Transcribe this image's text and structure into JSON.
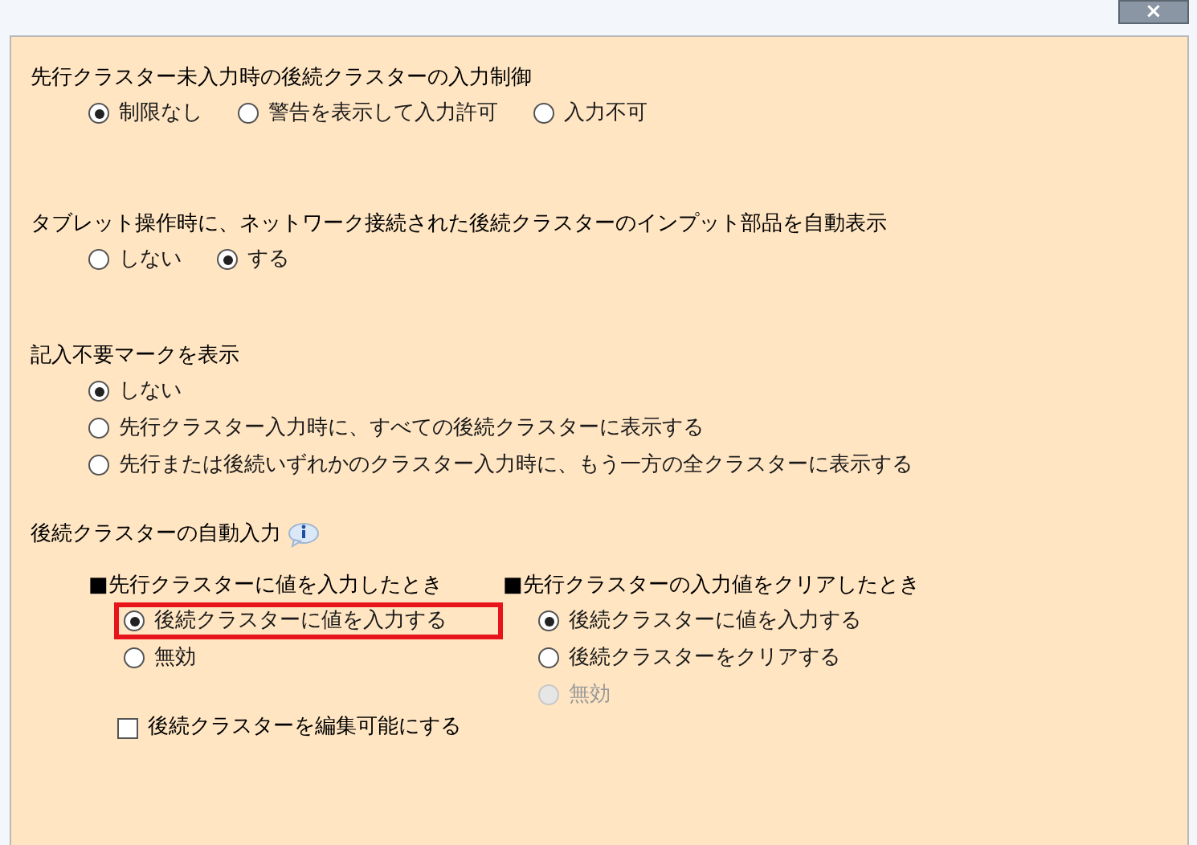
{
  "close_button": {
    "label": "×"
  },
  "sections": [
    {
      "title": "先行クラスター未入力時の後続クラスターの入力制御",
      "kind": "row",
      "options": [
        {
          "label": "制限なし",
          "selected": true
        },
        {
          "label": "警告を表示して入力許可",
          "selected": false
        },
        {
          "label": "入力不可",
          "selected": false
        }
      ]
    },
    {
      "title": "タブレット操作時に、ネットワーク接続された後続クラスターのインプット部品を自動表示",
      "kind": "row",
      "options": [
        {
          "label": "しない",
          "selected": false
        },
        {
          "label": "する",
          "selected": true
        }
      ]
    },
    {
      "title": "記入不要マークを表示",
      "kind": "column",
      "options": [
        {
          "label": "しない",
          "selected": true
        },
        {
          "label": "先行クラスター入力時に、すべての後続クラスターに表示する",
          "selected": false
        },
        {
          "label": "先行または後続いずれかのクラスター入力時に、もう一方の全クラスターに表示する",
          "selected": false
        }
      ]
    }
  ],
  "auto_input": {
    "title": "後続クラスターの自動入力",
    "groups": [
      {
        "heading": "■先行クラスターに値を入力したとき",
        "options": [
          {
            "label": "後続クラスターに値を入力する",
            "selected": true,
            "disabled": false,
            "highlighted": true
          },
          {
            "label": "無効",
            "selected": false,
            "disabled": false,
            "highlighted": false
          }
        ],
        "checkbox": {
          "label": "後続クラスターを編集可能にする",
          "checked": false
        }
      },
      {
        "heading": "■先行クラスターの入力値をクリアしたとき",
        "options": [
          {
            "label": "後続クラスターに値を入力する",
            "selected": true,
            "disabled": false,
            "highlighted": false
          },
          {
            "label": "後続クラスターをクリアする",
            "selected": false,
            "disabled": false,
            "highlighted": false
          },
          {
            "label": "無効",
            "selected": false,
            "disabled": true,
            "highlighted": false
          }
        ]
      }
    ]
  }
}
